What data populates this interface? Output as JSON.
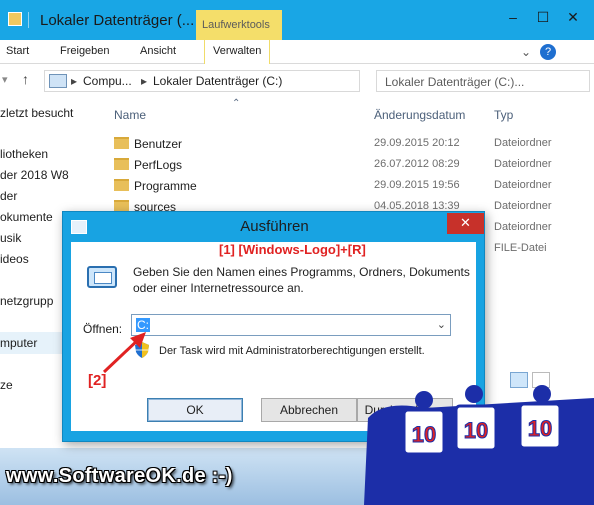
{
  "explorer": {
    "title": "Lokaler Datenträger (...",
    "contextual_tab": "Laufwerktools",
    "ribbon_tabs": [
      "Start",
      "Freigeben",
      "Ansicht",
      "Verwalten"
    ],
    "address": {
      "crumbs": [
        "Compu...",
        "Lokaler Datenträger (C:)"
      ]
    },
    "search_placeholder": "Lokaler Datenträger (C:)...",
    "nav_items": [
      "zletzt besucht",
      "liotheken",
      "der 2018 W8",
      "der",
      "okumente",
      "usik",
      "ideos",
      "netzgrupp",
      "mputer",
      "ze"
    ],
    "columns": [
      "Name",
      "Änderungsdatum",
      "Typ"
    ],
    "files": [
      {
        "name": "Benutzer",
        "date": "29.09.2015 20:12",
        "type": "Dateiordner"
      },
      {
        "name": "PerfLogs",
        "date": "26.07.2012 08:29",
        "type": "Dateiordner"
      },
      {
        "name": "Programme",
        "date": "29.09.2015 19:56",
        "type": "Dateiordner"
      },
      {
        "name": "sources",
        "date": "04.05.2018 13:39",
        "type": "Dateiordner"
      }
    ],
    "hidden_rows_type": [
      "Dateiordner",
      "FILE-Datei"
    ]
  },
  "run_dialog": {
    "title": "Ausführen",
    "description": "Geben Sie den Namen eines Programms, Ordners, Dokuments oder einer Internetressource an.",
    "open_label": "Öffnen:",
    "open_value": "C:",
    "admin_note": "Der Task wird mit Administratorberechtigungen erstellt.",
    "ok_label": "OK",
    "cancel_label": "Abbrechen",
    "browse_label": "Durchsuchen..."
  },
  "annotations": {
    "step1": "[1] [Windows-Logo]+[R]",
    "step2": "[2]"
  },
  "watermark": "www.SoftwareOK.de :-)",
  "mascots": [
    "10",
    "10",
    "10"
  ],
  "colors": {
    "titlebar": "#19a6e5",
    "accent_red": "#e02222",
    "close_red": "#c7312a",
    "mascot_blue": "#1c2ea8"
  }
}
